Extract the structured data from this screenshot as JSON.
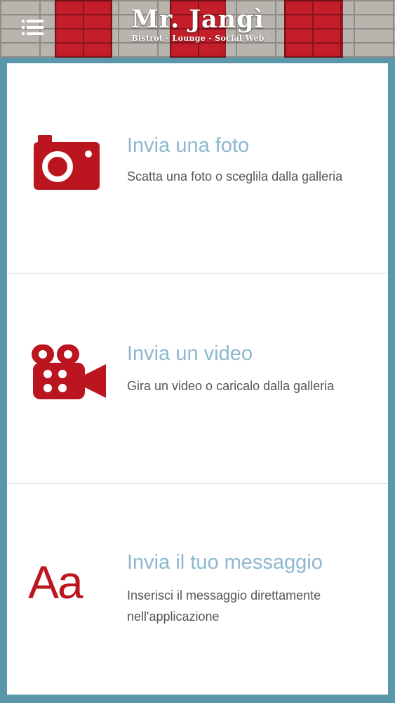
{
  "header": {
    "logo_title": "Mr. Jangì",
    "logo_subtitle": "Bistrot - Lounge - Social Web",
    "menu_icon": "hamburger-menu-icon"
  },
  "colors": {
    "accent_red": "#bb1520",
    "title_blue": "#8db8cf",
    "frame_blue": "#5b97aa",
    "description_gray": "#555555"
  },
  "items": [
    {
      "icon": "camera-icon",
      "title": "Invia una foto",
      "description": "Scatta una foto o sceglila dalla galleria"
    },
    {
      "icon": "video-camera-icon",
      "title": "Invia un video",
      "description": "Gira un video o caricalo dalla galleria"
    },
    {
      "icon": "text-icon",
      "icon_text": "Aa",
      "title": "Invia il tuo messaggio",
      "description": "Inserisci il messaggio direttamente nell'applicazione"
    }
  ]
}
